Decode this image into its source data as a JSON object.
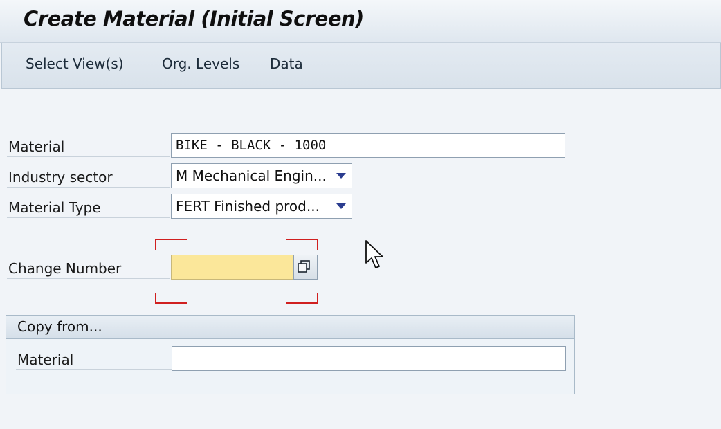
{
  "window": {
    "title": "Create Material (Initial Screen)"
  },
  "toolbar": {
    "select_views": "Select View(s)",
    "org_levels": "Org. Levels",
    "data": "Data"
  },
  "form": {
    "material_label": "Material",
    "material_value": "BIKE - BLACK - 1000",
    "industry_label": "Industry sector",
    "industry_value": "M Mechanical Engin...",
    "material_type_label": "Material Type",
    "material_type_value": "FERT Finished prod...",
    "change_number_label": "Change Number",
    "change_number_value": ""
  },
  "copy_from": {
    "title": "Copy from...",
    "material_label": "Material",
    "material_value": ""
  },
  "colors": {
    "highlight_bracket": "#d02020",
    "required_field": "#fbe79a",
    "dropdown_arrow": "#2a3c8f"
  },
  "icons": {
    "value_help": "value-help-icon",
    "dropdown": "triangle-down-icon",
    "cursor": "mouse-pointer-icon"
  }
}
